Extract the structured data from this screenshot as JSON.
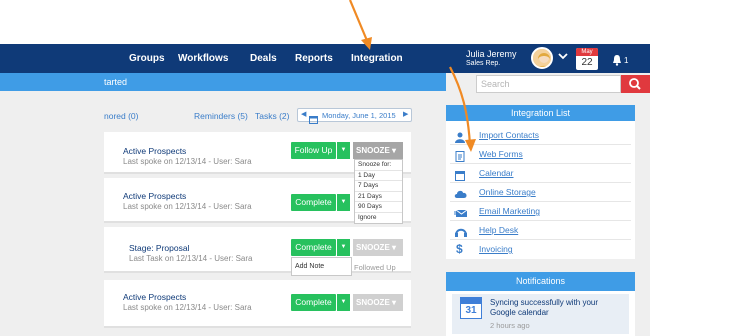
{
  "nav": {
    "items": [
      "Groups",
      "Workflows",
      "Deals",
      "Reports",
      "Integration"
    ],
    "user_name": "Julia Jeremy",
    "user_role": "Sales Rep.",
    "calendar_month": "May",
    "calendar_day": "22",
    "notification_count": "1"
  },
  "subbar": {
    "text": "tarted"
  },
  "search": {
    "placeholder": "Search"
  },
  "filters": {
    "ignored": "nored (0)",
    "reminders": "Reminders (5)",
    "tasks": "Tasks (2)",
    "date": "Monday, June 1, 2015"
  },
  "tasks": [
    {
      "title": "Active Prospects",
      "subtitle": "Last spoke on 12/13/14 - User: Sara",
      "action": "Follow Up",
      "snooze": "SNOOZE"
    },
    {
      "title": "Active Prospects",
      "subtitle": "Last spoke on 12/13/14 - User: Sara",
      "action": "Complete",
      "snooze": "SNOOZE"
    },
    {
      "title": "Stage: Proposal",
      "subtitle": "Last Task on 12/13/14 - User: Sara",
      "action": "Complete",
      "snooze": "SNOOZE"
    },
    {
      "title": "Active Prospects",
      "subtitle": "Last spoke on 12/13/14 - User: Sara",
      "action": "Complete",
      "snooze": "SNOOZE"
    }
  ],
  "snooze_menu": {
    "header": "Snooze for:",
    "options": [
      "1 Day",
      "7 Days",
      "21 Days",
      "90 Days",
      "Ignore"
    ]
  },
  "complete_menu": {
    "options": [
      "Add Note"
    ]
  },
  "followed_up_text": "Followed Up",
  "integration": {
    "title": "Integration List",
    "items": [
      {
        "label": "Import Contacts",
        "icon": "person-icon"
      },
      {
        "label": "Web Forms",
        "icon": "form-icon"
      },
      {
        "label": "Calendar",
        "icon": "calendar-icon"
      },
      {
        "label": "Online Storage",
        "icon": "cloud-icon"
      },
      {
        "label": "Email Marketing",
        "icon": "envelope-icon"
      },
      {
        "label": "Help Desk",
        "icon": "headset-icon"
      },
      {
        "label": "Invoicing",
        "icon": "dollar-icon"
      }
    ]
  },
  "notifications": {
    "title": "Notifications",
    "items": [
      {
        "text": "Syncing successfully with your Google calendar",
        "time": "2 hours ago",
        "day": "31"
      }
    ]
  },
  "colors": {
    "nav": "#0f3a78",
    "accent": "#3f9ce6",
    "green": "#27c15e",
    "red": "#e0393e",
    "annotation": "#f08a24"
  }
}
